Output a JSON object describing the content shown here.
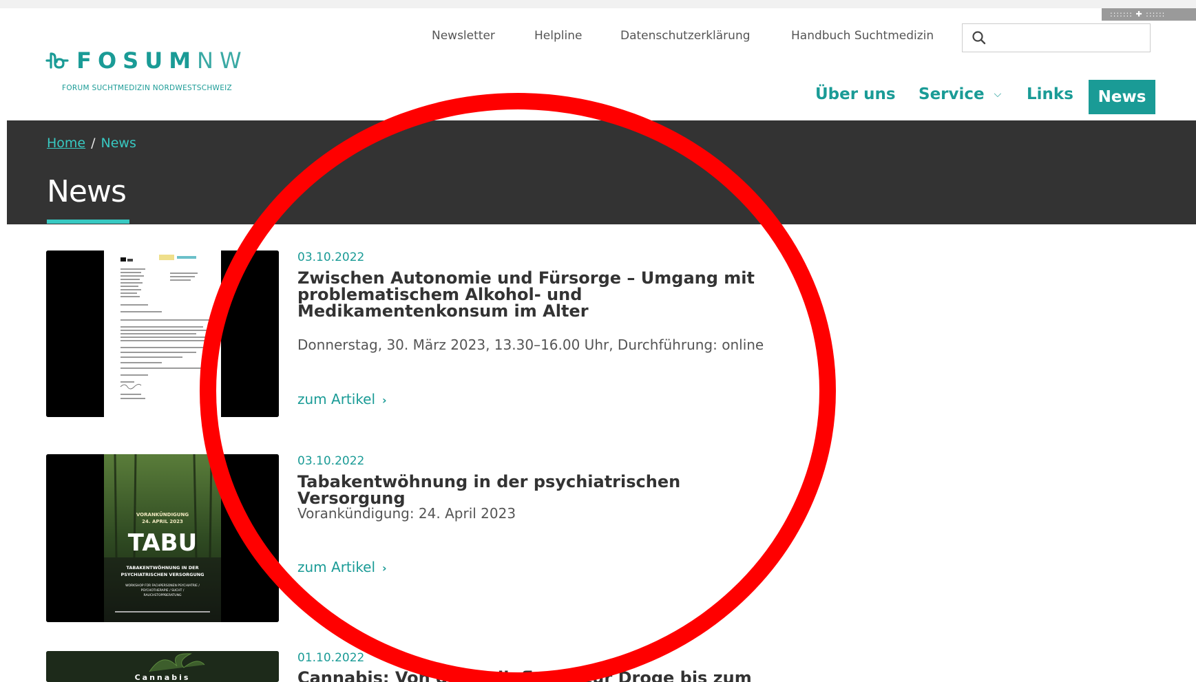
{
  "header": {
    "logo_text_bold": "FOSUM",
    "logo_text_thin": "NW",
    "logo_tagline": "FORUM SUCHTMEDIZIN NORDWESTSCHWEIZ",
    "utility_links": [
      "Newsletter",
      "Helpline",
      "Datenschutzerklärung",
      "Handbuch Suchtmedizin"
    ],
    "search": {
      "placeholder": "",
      "value": ""
    },
    "main_nav": {
      "about": "Über uns",
      "service": "Service",
      "links": "Links",
      "news": "News"
    },
    "corner_widget": "::::::: ✚ ::::::"
  },
  "banner": {
    "breadcrumb_home": "Home",
    "breadcrumb_separator": "/",
    "breadcrumb_current": "News",
    "title": "News"
  },
  "articles": [
    {
      "date": "03.10.2022",
      "title": "Zwischen Autonomie und Fürsorge – Umgang mit problematischem Alkohol- und Medikamentenkonsum im Alter",
      "description": "Donnerstag, 30. März 2023, 13.30–16.00 Uhr, Durchführung: online",
      "link": "zum Artikel"
    },
    {
      "date": "03.10.2022",
      "title": "Tabakentwöhnung in der psychiatrischen Versorgung",
      "description": "Vorankündigung: 24. April 2023",
      "link": "zum Artikel",
      "thumb_text": {
        "announce": "VORANKÜNDIGUNG",
        "announce_date": "24. APRIL 2023",
        "big": "TABU",
        "sub1": "TABAKENTWÖHNUNG IN DER",
        "sub2": "PSYCHIATRISCHEN VERSORGUNG",
        "sub3": "WORKSHOP FÜR FACHPERSONEN PSYCHIATRIE /",
        "sub4": "PSYCHOTHERAPIE / SUCHT /",
        "sub5": "RAUCHSTOPPBERATUNG"
      }
    },
    {
      "date": "01.10.2022",
      "title": "Cannabis: Von der Heilpflanze zur Droge bis zum",
      "thumb_text": {
        "label": "Cannabis"
      }
    }
  ],
  "colors": {
    "brand_teal": "#1a9b96",
    "banner_bg": "#333333",
    "annotation_red": "#ff0000"
  }
}
